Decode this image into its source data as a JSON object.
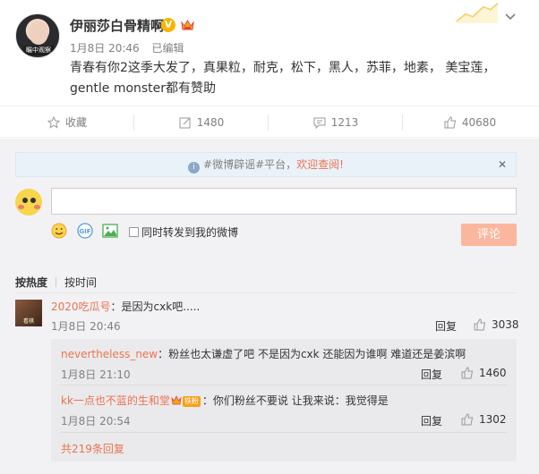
{
  "post": {
    "username": "伊丽莎白骨精啊",
    "avatar_label": "瞩中观察",
    "verified_badge": "V",
    "date": "1月8日 20:46",
    "edited": "已编辑",
    "text": "青春有你2这季大发了，真果粒，耐克，松下，黑人，苏菲，地素， 美宝莲，gentle monster都有赞助"
  },
  "actions": {
    "favorite": "收藏",
    "repost": "1480",
    "comment": "1213",
    "like": "40680"
  },
  "notice": {
    "text": "#微博辟谣#平台，",
    "link": "欢迎查阅!",
    "close": "✕"
  },
  "composer": {
    "placeholder": "",
    "forward_label": "同时转发到我的微博",
    "submit_label": "评论"
  },
  "sort": {
    "by_hot": "按热度",
    "by_time": "按时间"
  },
  "comment": {
    "avatar_label": "看棋",
    "user": "2020吃瓜号",
    "text": "：是因为cxk吧.....",
    "time": "1月8日 20:46",
    "reply_label": "回复",
    "likes": "3038"
  },
  "replies": [
    {
      "user": "nevertheless_new",
      "text": "：粉丝也太谦虚了吧 不是因为cxk 还能因为谁啊 难道还是姜滨啊",
      "time": "1月8日 21:10",
      "reply_label": "回复",
      "likes": "1460"
    },
    {
      "user": "kk一点也不蓝的生和堂",
      "badge": "铁粉",
      "text": "：你们粉丝不要说 让我来说：我觉得是",
      "time": "1月8日 20:54",
      "reply_label": "回复",
      "likes": "1302"
    }
  ],
  "more_replies": "共219条回复",
  "colors": {
    "accent": "#eb7350",
    "submit_disabled": "#fbb79d",
    "panel_bg": "#f2f2f5",
    "reply_bg": "#eaeaec",
    "notice_bg": "#eaf2f9"
  }
}
